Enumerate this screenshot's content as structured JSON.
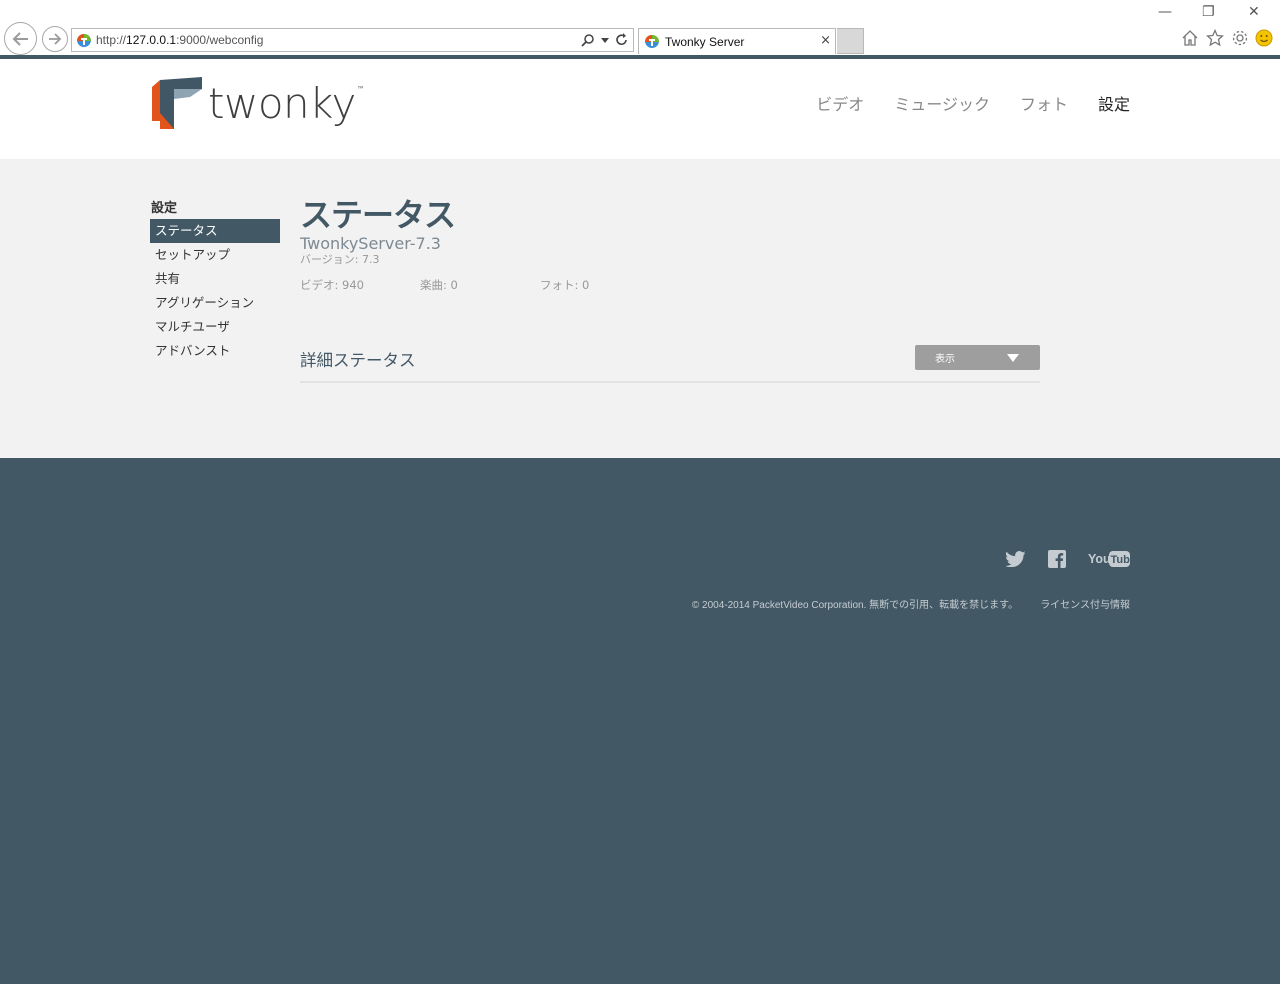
{
  "browser": {
    "url_scheme": "http://",
    "url_host": "127.0.0.1",
    "url_path": ":9000/webconfig",
    "tab_title": "Twonky Server",
    "tab_close": "×"
  },
  "header": {
    "logo_text": "twonky",
    "logo_tm": "™",
    "nav": [
      "ビデオ",
      "ミュージック",
      "フォト",
      "設定"
    ],
    "active_nav": "設定"
  },
  "sidebar": {
    "title": "設定",
    "items": [
      "ステータス",
      "セットアップ",
      "共有",
      "アグリゲーション",
      "マルチユーザ",
      "アドバンスト"
    ],
    "active_item": "ステータス"
  },
  "main": {
    "title": "ステータス",
    "server_name": "TwonkyServer-7.3",
    "version": "バージョン: 7.3",
    "counts": {
      "video": "ビデオ: 940",
      "music": "楽曲: 0",
      "photo": "フォト: 0"
    },
    "detail_title": "詳細ステータス",
    "show_button": "表示"
  },
  "footer": {
    "copyright": "© 2004-2014 PacketVideo Corporation. 無断での引用、転載を禁じます。",
    "license_link": "ライセンス付与情報",
    "social_icons": [
      "twitter-icon",
      "facebook-icon",
      "youtube-icon"
    ],
    "youtube_label": "YouTube"
  },
  "colors": {
    "brand_dark": "#435865",
    "content_bg": "#f2f2f2",
    "button_gray": "#9e9e9e",
    "logo_orange": "#e2541c",
    "logo_slate": "#415766"
  }
}
